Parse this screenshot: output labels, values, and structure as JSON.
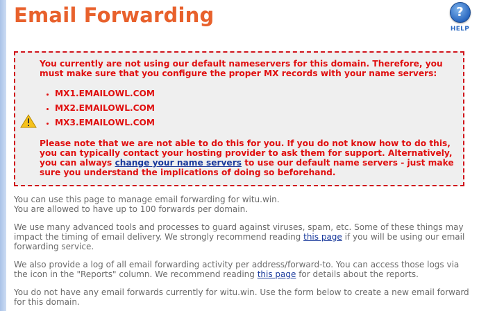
{
  "page": {
    "title": "Email Forwarding",
    "help_label": "HELP",
    "help_glyph": "?"
  },
  "warning": {
    "icon": "warning-triangle-icon",
    "intro": "You currently are not using our default nameservers for this domain. Therefore, you must make sure that you configure the proper MX records with your name servers:",
    "mx_records": [
      "MX1.EMAILOWL.COM",
      "MX2.EMAILOWL.COM",
      "MX3.EMAILOWL.COM"
    ],
    "note_before_link": "Please note that we are not able to do this for you. If you do not know how to do this, you can typically contact your hosting provider to ask them for support. Alternatively, you can always ",
    "note_link": "change your name servers",
    "note_after_link": " to use our default name servers - just make sure you understand the implications of doing so beforehand."
  },
  "info": {
    "line1": "You can use this page to manage email forwarding for witu.win.",
    "line2": "You are allowed to have up to 100 forwards per domain.",
    "para2_before": "We use many advanced tools and processes to guard against viruses, spam, etc. Some of these things may impact the timing of email delivery. We strongly recommend reading ",
    "para2_link": "this page",
    "para2_after": " if you will be using our email forwarding service.",
    "para3_before": "We also provide a log of all email forwarding activity per address/forward-to. You can access those logs via the icon in the \"Reports\" column. We recommend reading ",
    "para3_link": "this page",
    "para3_after": " for details about the reports.",
    "para4": "You do not have any email forwards currently for witu.win. Use the form below to create a new email forward for this domain."
  },
  "colors": {
    "title": "#e8612c",
    "warning_text": "#e01010",
    "warning_border": "#d0131a",
    "link": "#1a3a9c",
    "body_text": "#6a6a6a"
  }
}
